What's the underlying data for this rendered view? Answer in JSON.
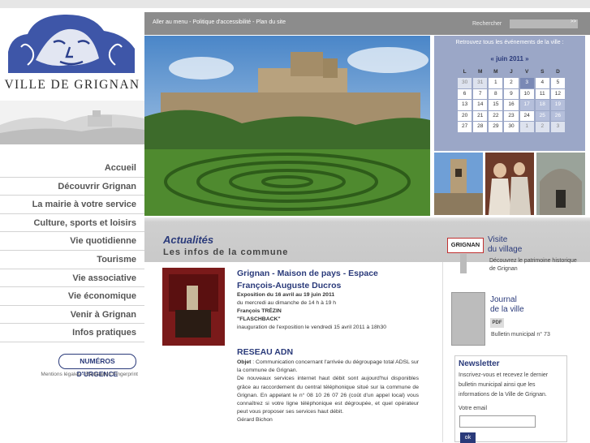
{
  "site": {
    "name": "VILLE DE GRIGNAN"
  },
  "nav": {
    "items": [
      {
        "label": "Accueil"
      },
      {
        "label": "Découvrir Grignan"
      },
      {
        "label": "La mairie à votre service"
      },
      {
        "label": "Culture, sports et loisirs"
      },
      {
        "label": "Vie quotidienne"
      },
      {
        "label": "Tourisme"
      },
      {
        "label": "Vie associative"
      },
      {
        "label": "Vie économique"
      },
      {
        "label": "Venir à Grignan"
      },
      {
        "label": "Infos pratiques"
      }
    ],
    "urgence_label": "NUMÉROS D'URGENCE",
    "legal": "Mentions légales - Réalisation Fingerprint"
  },
  "topbar": {
    "links": "Aller au menu - Politique d'accessibilité - Plan du site",
    "search_label": "Rechercher",
    "search_button": ">>"
  },
  "calendar": {
    "header": "Retrouvez tous les événements de la ville :",
    "month": "« juin 2011 »",
    "days": [
      "L",
      "M",
      "M",
      "J",
      "V",
      "S",
      "D"
    ],
    "weeks": [
      [
        "30",
        "31",
        "1",
        "2",
        "3",
        "4",
        "5"
      ],
      [
        "6",
        "7",
        "8",
        "9",
        "10",
        "11",
        "12"
      ],
      [
        "13",
        "14",
        "15",
        "16",
        "17",
        "18",
        "19"
      ],
      [
        "20",
        "21",
        "22",
        "23",
        "24",
        "25",
        "26"
      ],
      [
        "27",
        "28",
        "29",
        "30",
        "1",
        "2",
        "3"
      ]
    ]
  },
  "actualites": {
    "title": "Actualités",
    "subtitle": "Les infos de la commune",
    "news1": {
      "title": "Grignan - Maison de pays - Espace François-Auguste Ducros",
      "line1": "Exposition du 16 avril au 19 juin 2011",
      "line2": "du mercredi au dimanche de 14 h à 19 h",
      "line3": "François TRÉZIN",
      "line4": "\"FLASCHBACK\"",
      "line5": "inauguration de l'exposition le vendredi 15 avril 2011 à 18h30"
    },
    "news2": {
      "title": "RESEAU ADN",
      "objet_label": "Objet",
      "objet_text": " : Communication concernant l'arrivée du dégroupage total ADSL sur la commune de Grignan.",
      "body": "De nouveaux services internet haut débit sont aujourd'hui disponibles grâce au raccordement du central téléphonique situé sur la commune de Grignan. En appelant le n° 08 10 26 07 26 (coût d'un appel local) vous connaîtrez si votre ligne téléphonique est dégroupée, et quel opérateur peut vous proposer ses services haut débit.",
      "signature": "Gérard Bichon"
    }
  },
  "sidebar": {
    "visite": {
      "logo": "GRIGNAN",
      "title1": "Visite",
      "title2": "du village",
      "desc": "Découvrez le patrimoine historique de Grignan"
    },
    "journal": {
      "title1": "Journal",
      "title2": "de la ville",
      "pdf": "PDF",
      "desc": "Bulletin municipal n° 73"
    },
    "newsletter": {
      "title": "Newsletter",
      "text": "Inscrivez-vous et recevez le dernier bulletin municipal ainsi que les informations de la Ville de Grignan.",
      "email_label": "Votre email",
      "ok": "ok"
    }
  }
}
